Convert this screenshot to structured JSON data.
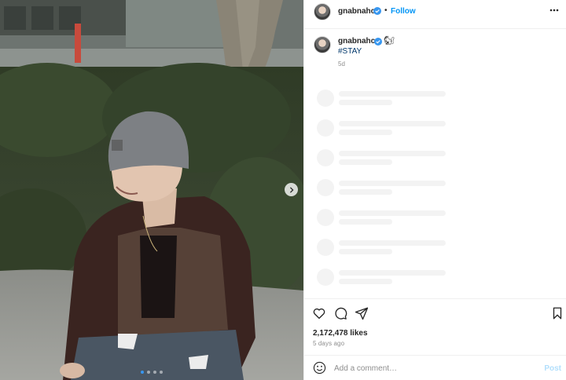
{
  "post": {
    "username": "gnabnahc",
    "verified": true,
    "follow_label": "Follow",
    "header_separator": "•",
    "caption_emoji": "🐿",
    "caption_text": "#STAY",
    "caption_time": "5d",
    "likes": "2,172,478 likes",
    "time_ago": "5 days ago"
  },
  "carousel": {
    "total": 4,
    "current": 1
  },
  "comment_box": {
    "placeholder": "Add a comment…",
    "post_label": "Post"
  },
  "colors": {
    "follow": "#0095f6",
    "hashtag": "#00376b",
    "post_disabled": "#b2dffc",
    "verified": "#3897f0"
  },
  "icons": [
    "verified-badge-icon",
    "more-options-icon",
    "chevron-right-icon",
    "heart-icon",
    "comment-icon",
    "share-icon",
    "bookmark-icon",
    "emoji-icon"
  ]
}
